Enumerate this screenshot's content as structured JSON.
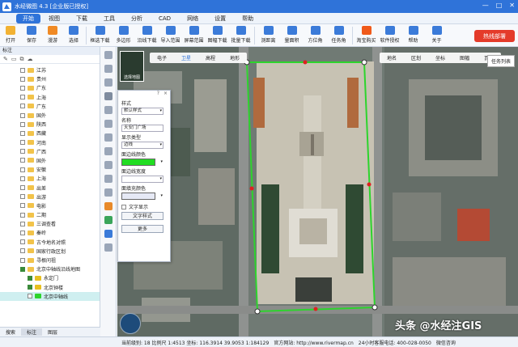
{
  "app": {
    "title": "水经微图 4.3 [企业版已授权]",
    "window_buttons": [
      "—",
      "□",
      "✕"
    ]
  },
  "menu": [
    "开始",
    "视图",
    "下载",
    "工具",
    "分析",
    "CAD",
    "网络",
    "设置",
    "帮助"
  ],
  "toolbar": [
    {
      "label": "打开",
      "icon": "folder-icon",
      "color": "#f2b233"
    },
    {
      "label": "保存",
      "icon": "save-icon",
      "color": "#3b7bd9"
    },
    {
      "label": "漫游",
      "icon": "hand-icon",
      "color": "#f08a24"
    },
    {
      "label": "选择",
      "icon": "cursor-icon",
      "color": "#3b7bd9"
    },
    {
      "label": "框选下载",
      "icon": "box-download-icon",
      "color": "#3b7bd9"
    },
    {
      "label": "多边形",
      "icon": "polygon-icon",
      "color": "#3b7bd9"
    },
    {
      "label": "沿线下载",
      "icon": "line-download-icon",
      "color": "#3b7bd9"
    },
    {
      "label": "导入范围",
      "icon": "import-icon",
      "color": "#3b7bd9"
    },
    {
      "label": "屏幕范围",
      "icon": "screen-icon",
      "color": "#3b7bd9"
    },
    {
      "label": "图幅下载",
      "icon": "sheet-icon",
      "color": "#3b7bd9"
    },
    {
      "label": "批量下载",
      "icon": "batch-icon",
      "color": "#3b7bd9"
    },
    {
      "label": "测距离",
      "icon": "ruler-icon",
      "color": "#3b7bd9"
    },
    {
      "label": "量面积",
      "icon": "area-icon",
      "color": "#3b7bd9"
    },
    {
      "label": "方位角",
      "icon": "angle-icon",
      "color": "#3b7bd9"
    },
    {
      "label": "任务角",
      "icon": "task-icon",
      "color": "#3b7bd9"
    },
    {
      "label": "淘宝购买",
      "icon": "taobao-icon",
      "color": "#f05a1a"
    },
    {
      "label": "软件授权",
      "icon": "license-icon",
      "color": "#3b7bd9"
    },
    {
      "label": "帮助",
      "icon": "help-icon",
      "color": "#3b7bd9"
    },
    {
      "label": "关于",
      "icon": "about-icon",
      "color": "#3b7bd9"
    }
  ],
  "hotline_label": "热线部署",
  "left_panel": {
    "title": "标注",
    "tree": [
      {
        "label": "江苏",
        "level": 0,
        "checked": false
      },
      {
        "label": "贵州",
        "level": 0,
        "checked": false
      },
      {
        "label": "广东",
        "level": 0,
        "checked": false
      },
      {
        "label": "上海",
        "level": 0,
        "checked": false
      },
      {
        "label": "广东",
        "level": 0,
        "checked": false
      },
      {
        "label": "国外",
        "level": 0,
        "checked": false
      },
      {
        "label": "陕西",
        "level": 0,
        "checked": false
      },
      {
        "label": "西藏",
        "level": 0,
        "checked": false
      },
      {
        "label": "河南",
        "level": 0,
        "checked": false
      },
      {
        "label": "广西",
        "level": 0,
        "checked": false
      },
      {
        "label": "国外",
        "level": 0,
        "checked": false
      },
      {
        "label": "安徽",
        "level": 0,
        "checked": false
      },
      {
        "label": "上海",
        "level": 0,
        "checked": false
      },
      {
        "label": "出差",
        "level": 0,
        "checked": false
      },
      {
        "label": "出游",
        "level": 0,
        "checked": false
      },
      {
        "label": "电影",
        "level": 0,
        "checked": false
      },
      {
        "label": "二期",
        "level": 0,
        "checked": false
      },
      {
        "label": "三调查看",
        "level": 0,
        "checked": false
      },
      {
        "label": "秦岭",
        "level": 0,
        "checked": false
      },
      {
        "label": "古今地名对照",
        "level": 0,
        "checked": false
      },
      {
        "label": "国家行政区划",
        "level": 0,
        "checked": false
      },
      {
        "label": "寻根问祖",
        "level": 0,
        "checked": false
      },
      {
        "label": "北京中轴线沿线地图",
        "level": 0,
        "checked": true
      },
      {
        "label": "永定门",
        "level": 1,
        "checked": true
      },
      {
        "label": "北京钟楼",
        "level": 1,
        "checked": true
      },
      {
        "label": "北京中轴线",
        "level": 2,
        "checked": false
      }
    ],
    "bottom_tabs": [
      "搜索",
      "标注",
      "图层"
    ],
    "bottom_active": "标注"
  },
  "map": {
    "base_tabs": [
      "电子",
      "卫星",
      "高程",
      "地形"
    ],
    "base_active": "卫星",
    "overlay_tabs": [
      "地名",
      "区划",
      "坐标",
      "图幅",
      "瓦片"
    ],
    "task_list_label": "任务列表",
    "thumb_label": "选择地图"
  },
  "style_panel": {
    "style_label": "样式",
    "style_value": "默认样式",
    "name_label": "名称",
    "name_value": "天安门广场",
    "display_type_label": "显示类型",
    "display_type_value": "边线",
    "line_color_label": "面边线颜色",
    "line_color": "#22dd22",
    "line_width_label": "面边线宽度",
    "line_width_value": "",
    "fill_color_label": "面填充颜色",
    "fill_color": "#e6e9f5",
    "text_show_label": "文字显示",
    "text_style_button": "文字样式",
    "more_button": "更多"
  },
  "status": {
    "text": "当前级别: 18  比例尺 1:4513  坐标: 116.3914 39.9053  1:184129",
    "website": "官方网站: http://www.rivermap.cn",
    "service": "24小时客服电话: 400-028-0050",
    "wechat": "微信咨询"
  },
  "watermark": "头条 @水经注GIS"
}
